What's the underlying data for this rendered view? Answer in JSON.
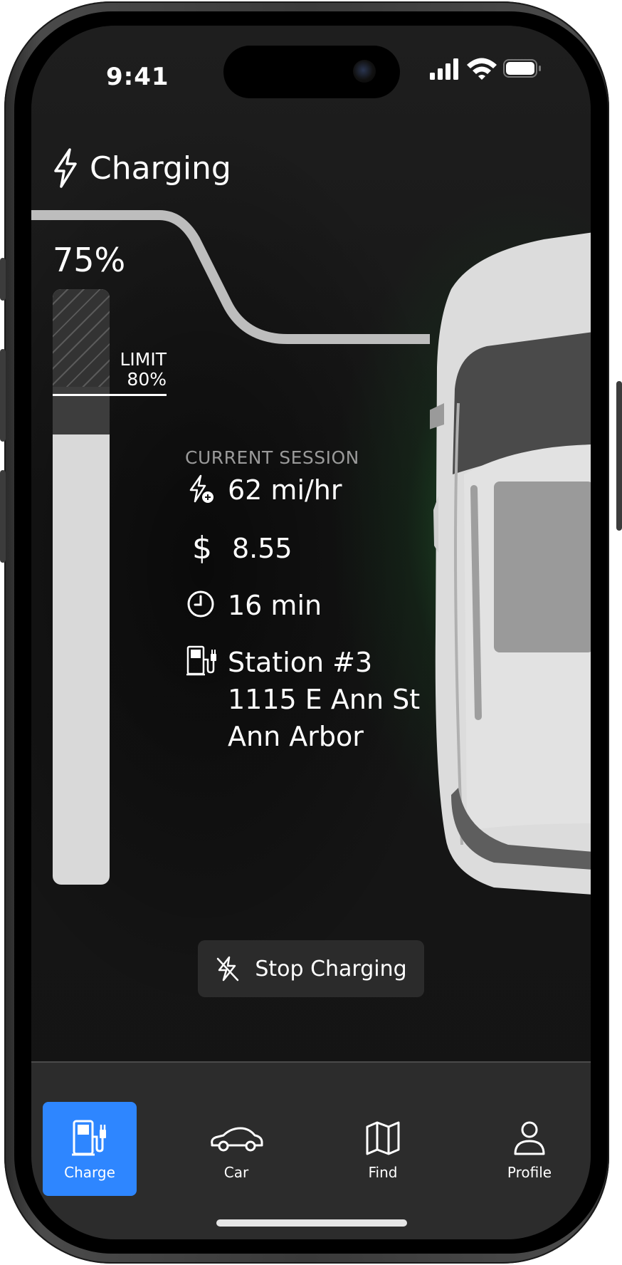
{
  "status_bar": {
    "time": "9:41"
  },
  "header": {
    "title": "Charging",
    "icon": "bolt-icon"
  },
  "battery": {
    "percent_label": "75%",
    "level": 75,
    "limit_label": "LIMIT",
    "limit_value": "80%",
    "limit": 80
  },
  "session": {
    "label": "CURRENT SESSION",
    "rate": "62 mi/hr",
    "cost": "8.55",
    "time": "16 min",
    "station_name": "Station #3",
    "station_street": "1115 E Ann St",
    "station_city": "Ann Arbor"
  },
  "actions": {
    "stop_label": "Stop Charging"
  },
  "tabs": [
    {
      "label": "Charge",
      "icon": "charging-station-icon",
      "active": true
    },
    {
      "label": "Car",
      "icon": "car-icon",
      "active": false
    },
    {
      "label": "Find",
      "icon": "map-icon",
      "active": false
    },
    {
      "label": "Profile",
      "icon": "person-icon",
      "active": false
    }
  ],
  "colors": {
    "accent": "#2e86ff",
    "glow": "#1f7a35",
    "background": "#141414"
  }
}
